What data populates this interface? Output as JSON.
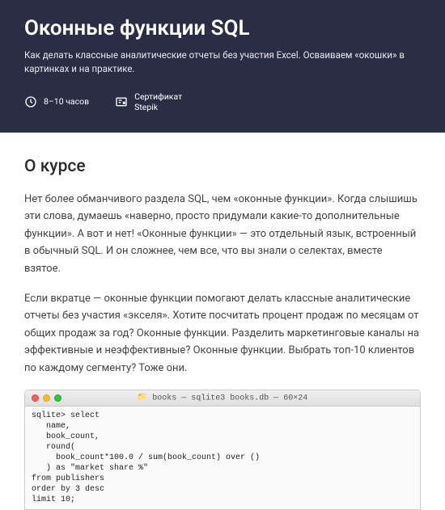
{
  "hero": {
    "title": "Оконные функции SQL",
    "subtitle": "Как делать классные аналитические отчеты без участия Excel. Осваиваем «окошки» в картинках и на практике.",
    "duration": "8–10 часов",
    "certificate_label": "Сертификат",
    "certificate_provider": "Stepik"
  },
  "about": {
    "heading": "О курсе",
    "p1": "Нет более обманчивого раздела SQL, чем «оконные функции». Когда слышишь эти слова, думаешь «наверно, просто придумали какие-то дополнительные функции». А вот и нет! «Оконные функции» — это отдельный язык, встроенный в обычный SQL. И он сложнее, чем все, что вы знали о селектах, вместе взятое.",
    "p2": "Если вкратце — оконные функции помогают делать классные аналитические отчеты без участия «экселя». Хотите посчитать процент продаж по месяцам от общих продаж за год? Оконные функции. Разделить маркетинговые каналы на эффективные и неэффективные? Оконные функции. Выбрать топ-10 клиентов по каждому сегменту? Тоже они."
  },
  "terminal": {
    "title": "books — sqlite3 books.db — 60×24",
    "code": "sqlite> select\n   name,\n   book_count,\n   round(\n     book_count*100.0 / sum(book_count) over ()\n   ) as \"market share %\"\nfrom publishers\norder by 3 desc\nlimit 10;"
  }
}
